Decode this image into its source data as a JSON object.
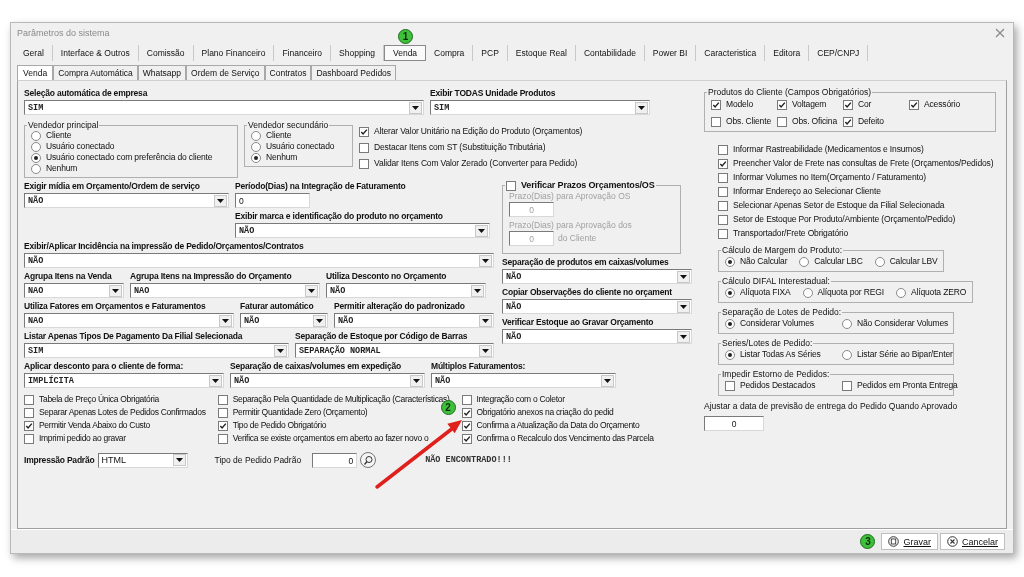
{
  "window": {
    "title": "Parâmetros do sistema"
  },
  "tabs": [
    {
      "label": "Geral",
      "selected": false
    },
    {
      "label": "Interface & Outros",
      "selected": false
    },
    {
      "label": "Comissão",
      "selected": false
    },
    {
      "label": "Plano Financeiro",
      "selected": false
    },
    {
      "label": "Financeiro",
      "selected": false
    },
    {
      "label": "Shopping",
      "selected": false
    },
    {
      "label": "Venda",
      "selected": true,
      "marker": "1"
    },
    {
      "label": "Compra",
      "selected": false
    },
    {
      "label": "PCP",
      "selected": false
    },
    {
      "label": "Estoque Real",
      "selected": false
    },
    {
      "label": "Contabilidade",
      "selected": false
    },
    {
      "label": "Power BI",
      "selected": false
    },
    {
      "label": "Caracteristica",
      "selected": false
    },
    {
      "label": "Editora",
      "selected": false
    },
    {
      "label": "CEP/CNPJ",
      "selected": false
    }
  ],
  "subtabs": [
    {
      "label": "Venda",
      "selected": true
    },
    {
      "label": "Compra Automática",
      "selected": false
    },
    {
      "label": "Whatsapp",
      "selected": false
    },
    {
      "label": "Ordem de Serviço",
      "selected": false
    },
    {
      "label": "Contratos",
      "selected": false
    },
    {
      "label": "Dashboard Pedidos",
      "selected": false
    }
  ],
  "empresa": {
    "label": "Seleção automática de empresa",
    "value": "SIM"
  },
  "unidades": {
    "label": "Exibir TODAS Unidade Produtos",
    "value": "SIM"
  },
  "vendedor_principal": {
    "title": "Vendedor principal",
    "options": [
      {
        "label": "Cliente",
        "selected": false
      },
      {
        "label": "Usuário conectado",
        "selected": false
      },
      {
        "label": "Usuário conectado com preferência do cliente",
        "selected": true
      },
      {
        "label": "Nenhum",
        "selected": false
      }
    ]
  },
  "vendedor_secundario": {
    "title": "Vendedor secundário",
    "options": [
      {
        "label": "Cliente",
        "selected": false
      },
      {
        "label": "Usuário conectado",
        "selected": false
      },
      {
        "label": "Nenhum",
        "selected": true
      }
    ]
  },
  "opcoes_edicao": [
    {
      "label": "Alterar Valor Unitário na Edição do Produto (Orçamentos)",
      "checked": true
    },
    {
      "label": "Destacar Itens com ST (Substituição Tributária)",
      "checked": false
    },
    {
      "label": "Validar Itens Com Valor Zerado (Converter para Pedido)",
      "checked": false
    }
  ],
  "exigir_midia": {
    "label": "Exigir mídia em Orçamento/Ordem de serviço",
    "value": "NÃO"
  },
  "periodo": {
    "label": "Período(Dias) na Integração de Faturamento",
    "value": "0"
  },
  "exibir_marca": {
    "label": "Exibir marca e identificação do produto no orçamento",
    "value": "NÃO"
  },
  "prazos": {
    "label": "Verificar Prazos Orçamentos/OS",
    "checked": false,
    "disabled": true,
    "fields": [
      {
        "label": "Prazo(Dias) para Aprovação OS",
        "value": "0"
      },
      {
        "label": "Prazo(Dias) para Aprovação dos",
        "value": "0",
        "suffix": "do Cliente"
      }
    ]
  },
  "incidencia": {
    "label": "Exibir/Aplicar Incidência na impressão de Pedido/Orçamentos/Contratos",
    "value": "NÃO"
  },
  "linha_agrupa": [
    {
      "label": "Agrupa Itens na Venda",
      "value": "NAO"
    },
    {
      "label": "Agrupa Itens na Impressão do Orçamento",
      "value": "NAO"
    },
    {
      "label": "Utiliza Desconto no Orçamento",
      "value": "NÃO"
    }
  ],
  "linha_fatores": [
    {
      "label": "Utiliza Fatores em Orçamentos e Faturamentos",
      "value": "NAO"
    },
    {
      "label": "Faturar automático",
      "value": "NÃO"
    },
    {
      "label": "Permitir alteração do padronizado",
      "value": "NÃO"
    }
  ],
  "linha_pagamento": [
    {
      "label": "Listar Apenas Tipos De Pagamento Da Filial Selecionada",
      "value": "SIM"
    },
    {
      "label": "Separação de Estoque por Código de Barras",
      "value": "SEPARAÇÃO NORMAL"
    }
  ],
  "coluna_direita": [
    {
      "label": "Separação de produtos em caixas/volumes",
      "value": "NÃO"
    },
    {
      "label": "Copiar Observações do cliente no orçament",
      "value": "NÃO"
    },
    {
      "label": "Verificar Estoque ao Gravar Orçamento",
      "value": "NÃO"
    }
  ],
  "linha_desconto": [
    {
      "label": "Aplicar desconto para o cliente de forma:",
      "value": "IMPLÍCITA"
    },
    {
      "label": "Separação de caixas/volumes em expedição",
      "value": "NÃO"
    },
    {
      "label": "Múltiplos Faturamentos:",
      "value": "NÃO"
    }
  ],
  "check_colunas": [
    [
      {
        "label": "Tabela de Preço Única Obrigatória",
        "checked": false
      },
      {
        "label": "Separar Apenas Lotes de Pedidos Confirmados",
        "checked": false
      },
      {
        "label": "Permitir Venda Abaixo do Custo",
        "checked": true
      },
      {
        "label": "Imprimi pedido ao gravar",
        "checked": false
      }
    ],
    [
      {
        "label": "Separação Pela Quantidade de Multiplicação (Características)",
        "checked": false
      },
      {
        "label": "Permitir Quantidade Zero (Orçamento)",
        "checked": false
      },
      {
        "label": "Tipo de Pedido Obrigatório",
        "checked": true
      },
      {
        "label": "Verifica se existe orçamentos em aberto ao fazer novo o",
        "checked": false
      }
    ],
    [
      {
        "label": "Integração com o Coletor",
        "checked": false
      },
      {
        "label": "Obrigatório anexos na criação do pedid",
        "checked": true,
        "marker": "2",
        "arrow": true
      },
      {
        "label": "Confirma a Atualização da Data do Orçamento",
        "checked": true
      },
      {
        "label": "Confirma o Recalculo dos Vencimento das Parcela",
        "checked": true
      }
    ]
  ],
  "impressao": {
    "label": "Impressão Padrão",
    "value": "HTML"
  },
  "tipo_pedido": {
    "label": "Tipo de Pedido Padrão",
    "value": "0",
    "status": "NÃO ENCONTRADO!!!"
  },
  "produtos_cliente": {
    "title": "Produtos do Cliente (Campos Obrigatórios)",
    "items": [
      {
        "label": "Modelo",
        "checked": true
      },
      {
        "label": "Voltagem",
        "checked": true
      },
      {
        "label": "Cor",
        "checked": true
      },
      {
        "label": "Acessório",
        "checked": true
      },
      {
        "label": "Obs. Cliente",
        "checked": false
      },
      {
        "label": "Obs. Oficina",
        "checked": false
      },
      {
        "label": "Defeito",
        "checked": true
      }
    ]
  },
  "opcoes_gerais": [
    {
      "label": "Informar Rastreabilidade (Medicamentos e Insumos)",
      "checked": false
    },
    {
      "label": "Preencher Valor de Frete nas consultas de Frete (Orçamentos/Pedidos)",
      "checked": true
    },
    {
      "label": "Informar Volumes no Item(Orçamento / Faturamento)",
      "checked": false
    },
    {
      "label": "Informar Endereço ao Selecionar Cliente",
      "checked": false
    },
    {
      "label": "Selecionar Apenas Setor de Estoque da Filial Selecionada",
      "checked": false
    },
    {
      "label": "Setor de Estoque Por Produto/Ambiente (Orçamento/Pedido)",
      "checked": false
    },
    {
      "label": "Transportador/Frete Obrigatório",
      "checked": false
    }
  ],
  "grupos_radio": [
    {
      "title": "Cálculo de Margem do Produto:",
      "options": [
        {
          "label": "Não Calcular",
          "selected": true
        },
        {
          "label": "Calcular LBC",
          "selected": false
        },
        {
          "label": "Calcular LBV",
          "selected": false
        }
      ]
    },
    {
      "title": "Cálculo DIFAL Interestadual:",
      "options": [
        {
          "label": "Alíquota FIXA",
          "selected": true
        },
        {
          "label": "Alíquota por REGI",
          "selected": false
        },
        {
          "label": "Alíquota ZERO",
          "selected": false
        }
      ]
    },
    {
      "title": "Separação de Lotes de Pedido:",
      "options": [
        {
          "label": "Considerar Volumes",
          "selected": true
        },
        {
          "label": "Não Considerar Volumes",
          "selected": false
        }
      ]
    },
    {
      "title": "Series/Lotes de Pedido:",
      "options": [
        {
          "label": "Listar Todas As Séries",
          "selected": true
        },
        {
          "label": "Listar Série ao Bipar/Enter",
          "selected": false
        }
      ]
    }
  ],
  "estorno": {
    "title": "Impedir Estorno de Pedidos:",
    "items": [
      {
        "label": "Pedidos Destacados",
        "checked": false
      },
      {
        "label": "Pedidos em Pronta Entrega",
        "checked": false
      }
    ]
  },
  "ajustar": {
    "label": "Ajustar a data de previsão de entrega do Pedido Quando Aprovado",
    "value": "0"
  },
  "buttons": [
    {
      "label": "Gravar",
      "kind": "save",
      "marker": "3"
    },
    {
      "label": "Cancelar",
      "kind": "cancel"
    }
  ]
}
